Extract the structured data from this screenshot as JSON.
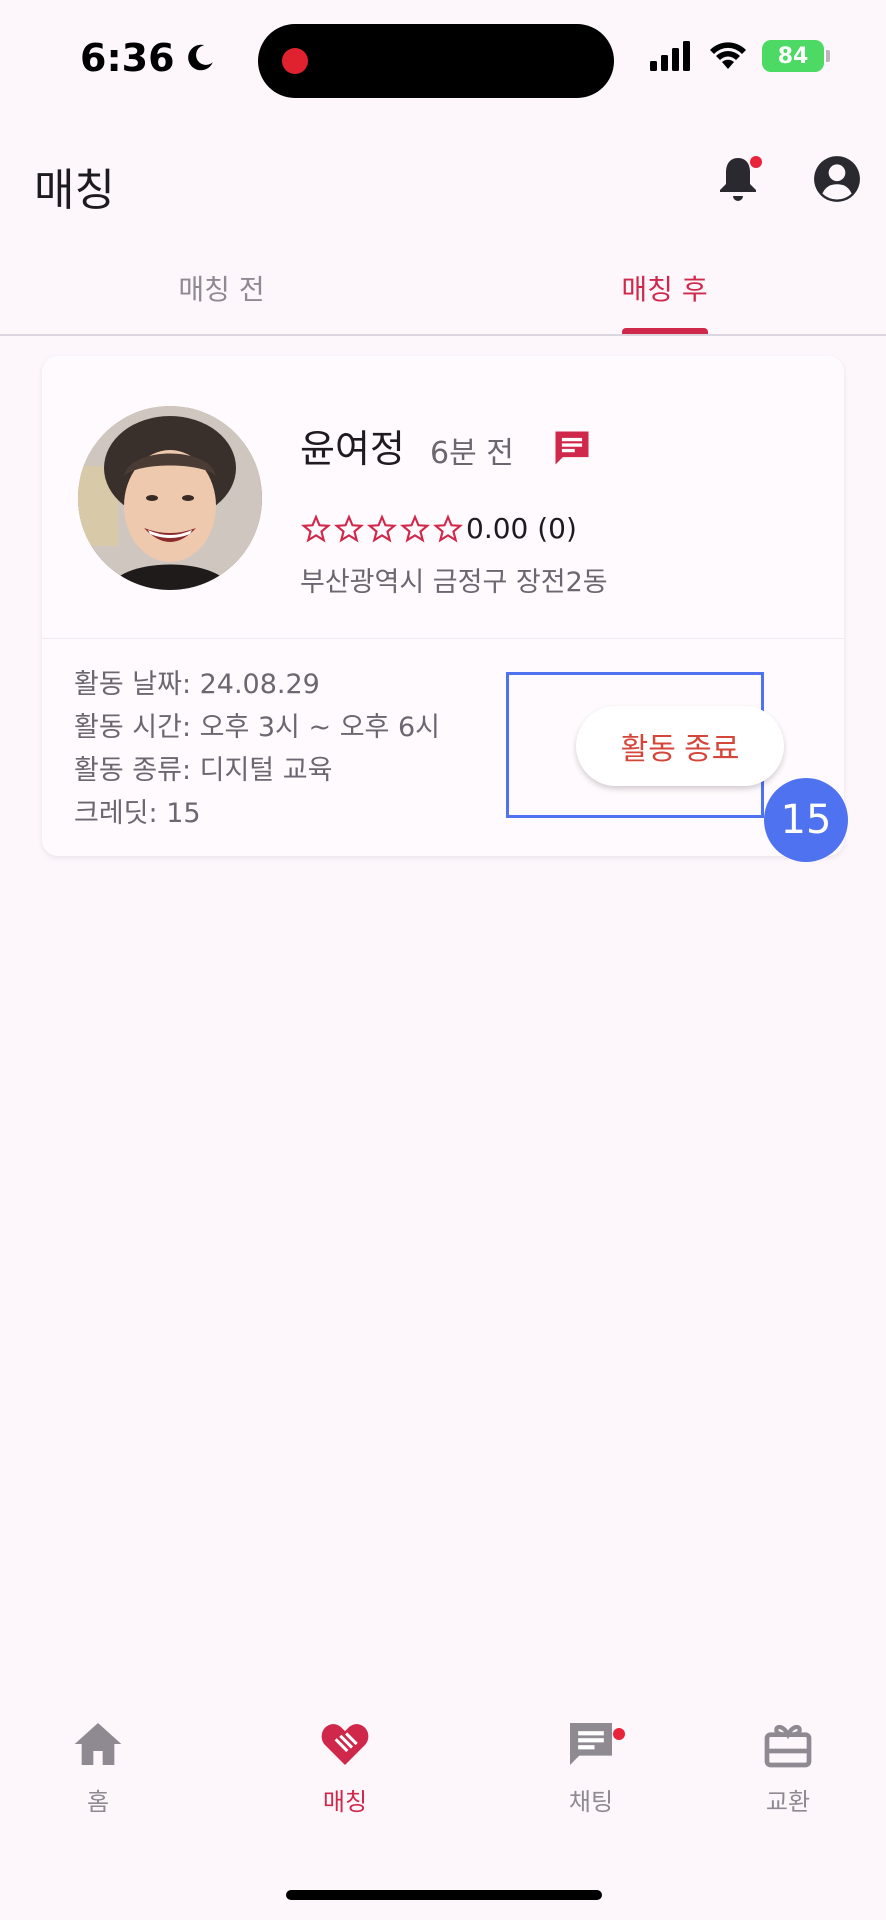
{
  "status_bar": {
    "time": "6:36",
    "battery": "84"
  },
  "header": {
    "title": "매칭"
  },
  "tabs": [
    {
      "label": "매칭 전",
      "selected": false
    },
    {
      "label": "매칭 후",
      "selected": true
    }
  ],
  "card": {
    "name": "윤여정",
    "time_ago": "6분 전",
    "rating_text": "0.00 (0)",
    "location": "부산광역시 금정구 장전2동",
    "details": [
      "활동 날짜: 24.08.29",
      "활동 시간: 오후 3시 ~ 오후 6시",
      "활동 종류: 디지털 교육",
      "크레딧: 15"
    ],
    "end_button_label": "활동 종료",
    "annotation_number": "15"
  },
  "bottom_nav": {
    "items": [
      {
        "label": "홈",
        "icon": "home-icon",
        "selected": false
      },
      {
        "label": "매칭",
        "icon": "handshake-icon",
        "selected": true
      },
      {
        "label": "채팅",
        "icon": "chat-icon",
        "selected": false
      },
      {
        "label": "교환",
        "icon": "gift-icon",
        "selected": false
      }
    ]
  },
  "colors": {
    "accent": "#d0284b",
    "highlight": "#4f73f0",
    "end_button_text": "#d5463a",
    "background": "#fdf7fc"
  }
}
